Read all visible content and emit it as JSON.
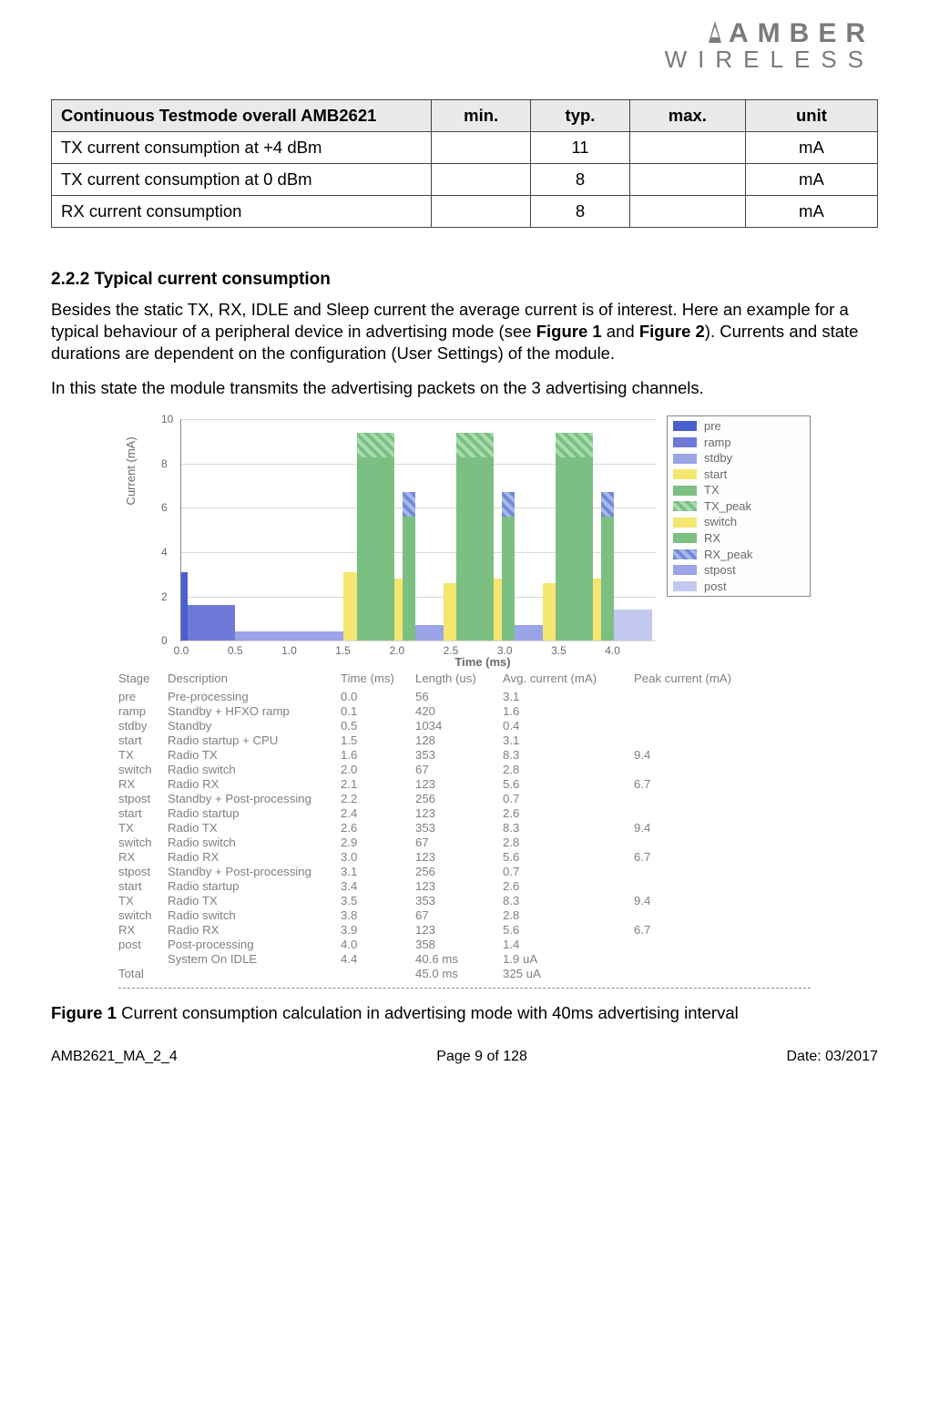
{
  "logo": {
    "top": "AMBER",
    "bottom": "WIRELESS"
  },
  "spec_table": {
    "headers": {
      "title": "Continuous Testmode overall AMB2621",
      "min": "min.",
      "typ": "typ.",
      "max": "max.",
      "unit": "unit"
    },
    "rows": [
      {
        "label": "TX current consumption at +4 dBm",
        "min": "",
        "typ": "11",
        "max": "",
        "unit": "mA"
      },
      {
        "label": "TX current consumption at 0 dBm",
        "min": "",
        "typ": "8",
        "max": "",
        "unit": "mA"
      },
      {
        "label": "RX current consumption",
        "min": "",
        "typ": "8",
        "max": "",
        "unit": "mA"
      }
    ]
  },
  "section": {
    "heading": "2.2.2 Typical current consumption",
    "p1a": "Besides the static TX, RX, IDLE and Sleep current the average current is of interest. Here an example for a typical behaviour of a peripheral device in advertising mode (see ",
    "fig1": "Figure 1",
    "p1b": " and ",
    "fig2": "Figure 2",
    "p1c": "). Currents and state durations are dependent on the configuration (User Settings) of the module.",
    "p2": "In this state the module transmits the advertising packets on the 3 advertising channels."
  },
  "chart_data": {
    "type": "bar",
    "xlabel": "Time (ms)",
    "ylabel": "Current (mA)",
    "xlim": [
      0.0,
      4.4
    ],
    "ylim": [
      0,
      10
    ],
    "xticks": [
      "0.0",
      "0.5",
      "1.0",
      "1.5",
      "2.0",
      "2.5",
      "3.0",
      "3.5",
      "4.0"
    ],
    "yticks": [
      "0",
      "2",
      "4",
      "6",
      "8",
      "10"
    ],
    "legend": [
      "pre",
      "ramp",
      "stdby",
      "start",
      "TX",
      "TX_peak",
      "switch",
      "RX",
      "RX_peak",
      "stpost",
      "post"
    ],
    "legend_colors": {
      "pre": "#4a5fd0",
      "ramp": "#6f79d8",
      "stdby": "#9aa4e6",
      "start": "#f4e670",
      "TX": "#7cbf82",
      "TX_peak": "hatch-g",
      "switch": "#f4e670",
      "RX": "#7cbf82",
      "RX_peak": "hatch-b",
      "stpost": "#9aa4e6",
      "post": "#c3c9ee"
    },
    "bars": [
      {
        "x0": 0.0,
        "x1": 0.056,
        "y": 3.1,
        "c": "#4a5fd0"
      },
      {
        "x0": 0.056,
        "x1": 0.5,
        "y": 1.6,
        "c": "#6f79d8"
      },
      {
        "x0": 0.5,
        "x1": 1.5,
        "y": 0.4,
        "c": "#9aa4e6"
      },
      {
        "x0": 1.5,
        "x1": 1.63,
        "y": 3.1,
        "c": "#f4e670"
      },
      {
        "x0": 1.63,
        "x1": 1.98,
        "y": 8.3,
        "c": "#7cbf82"
      },
      {
        "x0": 1.63,
        "x1": 1.98,
        "y0": 8.3,
        "y": 9.4,
        "c": "hatch-g"
      },
      {
        "x0": 1.98,
        "x1": 2.05,
        "y": 2.8,
        "c": "#f4e670"
      },
      {
        "x0": 2.05,
        "x1": 2.17,
        "y": 5.6,
        "c": "#7cbf82"
      },
      {
        "x0": 2.05,
        "x1": 2.17,
        "y0": 5.6,
        "y": 6.7,
        "c": "hatch-b"
      },
      {
        "x0": 2.17,
        "x1": 2.43,
        "y": 0.7,
        "c": "#9aa4e6"
      },
      {
        "x0": 2.43,
        "x1": 2.55,
        "y": 2.6,
        "c": "#f4e670"
      },
      {
        "x0": 2.55,
        "x1": 2.9,
        "y": 8.3,
        "c": "#7cbf82"
      },
      {
        "x0": 2.55,
        "x1": 2.9,
        "y0": 8.3,
        "y": 9.4,
        "c": "hatch-g"
      },
      {
        "x0": 2.9,
        "x1": 2.97,
        "y": 2.8,
        "c": "#f4e670"
      },
      {
        "x0": 2.97,
        "x1": 3.09,
        "y": 5.6,
        "c": "#7cbf82"
      },
      {
        "x0": 2.97,
        "x1": 3.09,
        "y0": 5.6,
        "y": 6.7,
        "c": "hatch-b"
      },
      {
        "x0": 3.09,
        "x1": 3.35,
        "y": 0.7,
        "c": "#9aa4e6"
      },
      {
        "x0": 3.35,
        "x1": 3.47,
        "y": 2.6,
        "c": "#f4e670"
      },
      {
        "x0": 3.47,
        "x1": 3.82,
        "y": 8.3,
        "c": "#7cbf82"
      },
      {
        "x0": 3.47,
        "x1": 3.82,
        "y0": 8.3,
        "y": 9.4,
        "c": "hatch-g"
      },
      {
        "x0": 3.82,
        "x1": 3.89,
        "y": 2.8,
        "c": "#f4e670"
      },
      {
        "x0": 3.89,
        "x1": 4.01,
        "y": 5.6,
        "c": "#7cbf82"
      },
      {
        "x0": 3.89,
        "x1": 4.01,
        "y0": 5.6,
        "y": 6.7,
        "c": "hatch-b"
      },
      {
        "x0": 4.01,
        "x1": 4.37,
        "y": 1.4,
        "c": "#c3c9ee"
      }
    ]
  },
  "stage_table": {
    "headers": [
      "Stage",
      "Description",
      "Time (ms)",
      "Length (us)",
      "Avg. current (mA)",
      "Peak current (mA)"
    ],
    "rows": [
      [
        "pre",
        "Pre-processing",
        "0.0",
        "56",
        "3.1",
        ""
      ],
      [
        "ramp",
        "Standby + HFXO ramp",
        "0.1",
        "420",
        "1.6",
        ""
      ],
      [
        "stdby",
        "Standby",
        "0.5",
        "1034",
        "0.4",
        ""
      ],
      [
        "start",
        "Radio startup + CPU",
        "1.5",
        "128",
        "3.1",
        ""
      ],
      [
        "TX",
        "Radio TX",
        "1.6",
        "353",
        "8.3",
        "9.4"
      ],
      [
        "switch",
        "Radio switch",
        "2.0",
        "67",
        "2.8",
        ""
      ],
      [
        "RX",
        "Radio RX",
        "2.1",
        "123",
        "5.6",
        "6.7"
      ],
      [
        "stpost",
        "Standby + Post-processing",
        "2.2",
        "256",
        "0.7",
        ""
      ],
      [
        "start",
        "Radio startup",
        "2.4",
        "123",
        "2.6",
        ""
      ],
      [
        "TX",
        "Radio TX",
        "2.6",
        "353",
        "8.3",
        "9.4"
      ],
      [
        "switch",
        "Radio switch",
        "2.9",
        "67",
        "2.8",
        ""
      ],
      [
        "RX",
        "Radio RX",
        "3.0",
        "123",
        "5.6",
        "6.7"
      ],
      [
        "stpost",
        "Standby + Post-processing",
        "3.1",
        "256",
        "0.7",
        ""
      ],
      [
        "start",
        "Radio startup",
        "3.4",
        "123",
        "2.6",
        ""
      ],
      [
        "TX",
        "Radio TX",
        "3.5",
        "353",
        "8.3",
        "9.4"
      ],
      [
        "switch",
        "Radio switch",
        "3.8",
        "67",
        "2.8",
        ""
      ],
      [
        "RX",
        "Radio RX",
        "3.9",
        "123",
        "5.6",
        "6.7"
      ],
      [
        "post",
        "Post-processing",
        "4.0",
        "358",
        "1.4",
        ""
      ],
      [
        "",
        "System On IDLE",
        "4.4",
        "40.6 ms",
        "1.9 uA",
        ""
      ],
      [
        "Total",
        "",
        "",
        "45.0 ms",
        "325 uA",
        ""
      ]
    ]
  },
  "figure_caption": {
    "label": "Figure 1",
    "text": " Current consumption calculation in advertising mode with 40ms advertising interval"
  },
  "footer": {
    "left": "AMB2621_MA_2_4",
    "center": "Page 9 of 128",
    "right": "Date: 03/2017"
  }
}
